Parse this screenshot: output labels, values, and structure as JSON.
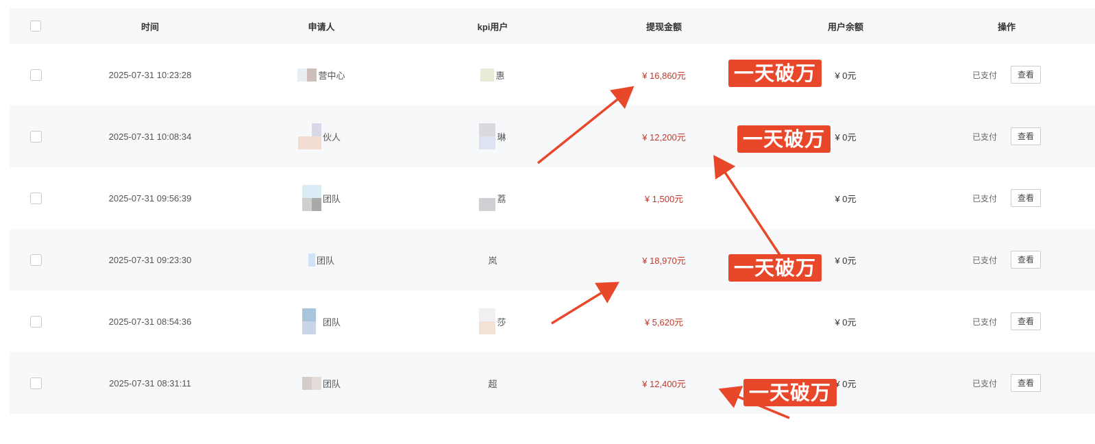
{
  "header": {
    "time": "时间",
    "applicant": "申请人",
    "kpi_user": "kpi用户",
    "withdraw_amount": "提现金额",
    "user_balance": "用户余额",
    "operation": "操作"
  },
  "rows": [
    {
      "time": "2025-07-31 10:23:28",
      "applicant": "营中心",
      "kpi": "惠",
      "amount": "¥ 16,860元",
      "balance": "¥ 0元",
      "status": "已支付",
      "action": "查看"
    },
    {
      "time": "2025-07-31 10:08:34",
      "applicant": "伙人",
      "kpi": "琳",
      "amount": "¥ 12,200元",
      "balance": "¥ 0元",
      "status": "已支付",
      "action": "查看"
    },
    {
      "time": "2025-07-31 09:56:39",
      "applicant": "团队",
      "kpi": "荔",
      "amount": "¥ 1,500元",
      "balance": "¥ 0元",
      "status": "已支付",
      "action": "查看"
    },
    {
      "time": "2025-07-31 09:23:30",
      "applicant": "团队",
      "kpi": "岚",
      "amount": "¥ 18,970元",
      "balance": "¥ 0元",
      "status": "已支付",
      "action": "查看"
    },
    {
      "time": "2025-07-31 08:54:36",
      "applicant": "团队",
      "kpi": "莎",
      "amount": "¥ 5,620元",
      "balance": "¥ 0元",
      "status": "已支付",
      "action": "查看"
    },
    {
      "time": "2025-07-31 08:31:11",
      "applicant": "团队",
      "kpi": "超",
      "amount": "¥ 12,400元",
      "balance": "¥ 0元",
      "status": "已支付",
      "action": "查看"
    }
  ],
  "annotations": {
    "badge_text": "一天破万"
  },
  "colors": {
    "accent": "#e8472a",
    "amount": "#c0392b",
    "stripe": "#f7f8fa"
  }
}
